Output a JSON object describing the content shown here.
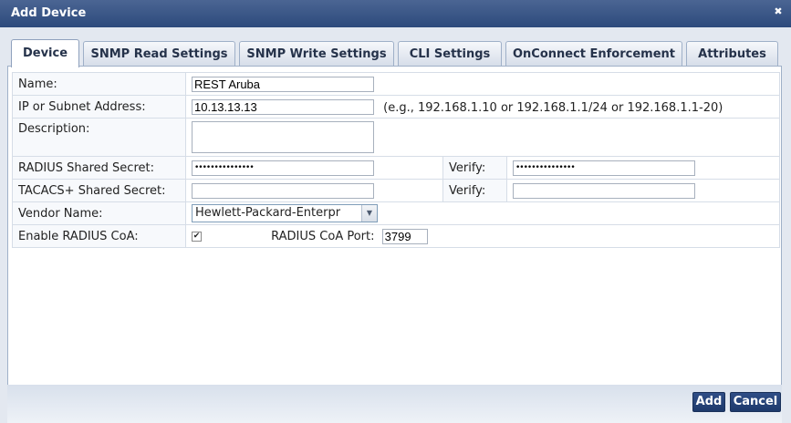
{
  "dialog": {
    "title": "Add Device"
  },
  "tabs": [
    {
      "label": "Device"
    },
    {
      "label": "SNMP Read Settings"
    },
    {
      "label": "SNMP Write Settings"
    },
    {
      "label": "CLI Settings"
    },
    {
      "label": "OnConnect Enforcement"
    },
    {
      "label": "Attributes"
    }
  ],
  "form": {
    "name": {
      "label": "Name:",
      "value": "REST Aruba"
    },
    "ip": {
      "label": "IP or Subnet Address:",
      "value": "10.13.13.13",
      "hint": "(e.g., 192.168.1.10 or 192.168.1.1/24 or 192.168.1.1-20)"
    },
    "description": {
      "label": "Description:",
      "value": ""
    },
    "radius_secret": {
      "label": "RADIUS Shared Secret:",
      "value": "•••••••••••••••",
      "verify_label": "Verify:",
      "verify_value": "•••••••••••••••"
    },
    "tacacs_secret": {
      "label": "TACACS+ Shared Secret:",
      "value": "",
      "verify_label": "Verify:",
      "verify_value": ""
    },
    "vendor": {
      "label": "Vendor Name:",
      "value": "Hewlett-Packard-Enterpr"
    },
    "coa": {
      "label": "Enable RADIUS CoA:",
      "checked": true,
      "port_label": "RADIUS CoA Port:",
      "port_value": "3799"
    }
  },
  "buttons": {
    "add": "Add",
    "cancel": "Cancel"
  }
}
